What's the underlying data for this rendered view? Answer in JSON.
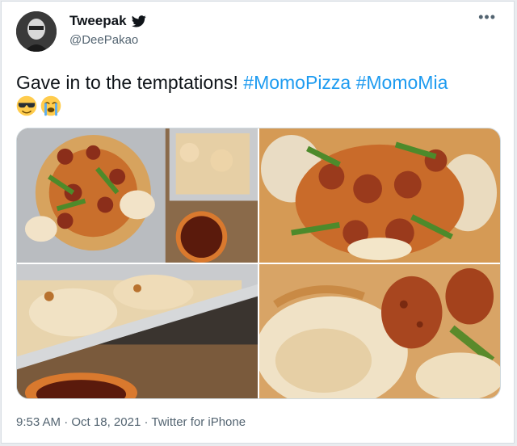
{
  "author": {
    "display_name": "Tweepak",
    "handle": "@DeePakao",
    "verified_icon": "verified-bird-icon"
  },
  "tweet": {
    "text_plain": "Gave in to the temptations! ",
    "hashtags": [
      "#MomoPizza",
      "#MomoMia"
    ],
    "emojis": [
      "smiling-face-with-sunglasses",
      "loudly-crying-face"
    ]
  },
  "media": {
    "photos": [
      "momo-pizza-tray",
      "momo-pizza-closeup",
      "momo-foil-tray",
      "momo-pizza-macro"
    ]
  },
  "meta": {
    "time": "9:53 AM",
    "sep": " · ",
    "date": "Oct 18, 2021",
    "source": "Twitter for iPhone"
  },
  "colors": {
    "link": "#1d9bf0",
    "text": "#0f1419",
    "muted": "#536471"
  }
}
